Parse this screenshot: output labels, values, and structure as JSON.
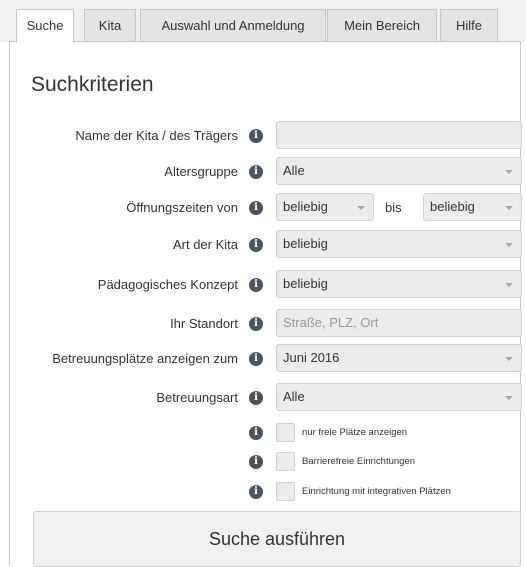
{
  "tabs": [
    {
      "label": "Suche",
      "active": true
    },
    {
      "label": "Kita",
      "active": false
    },
    {
      "label": "Auswahl und Anmeldung",
      "active": false
    },
    {
      "label": "Mein Bereich",
      "active": false
    },
    {
      "label": "Hilfe",
      "active": false
    }
  ],
  "page_title": "Suchkriterien",
  "info_glyph": "i",
  "form": {
    "name": {
      "label": "Name der Kita / des Trägers",
      "value": ""
    },
    "altersgruppe": {
      "label": "Altersgruppe",
      "value": "Alle"
    },
    "oeffnungszeiten": {
      "label": "Öffnungszeiten von",
      "from": "beliebig",
      "separator": "bis",
      "to": "beliebig"
    },
    "art": {
      "label": "Art der Kita",
      "value": "beliebig"
    },
    "konzept": {
      "label": "Pädagogisches Konzept",
      "value": "beliebig"
    },
    "standort": {
      "label": "Ihr Standort",
      "placeholder": "Straße, PLZ, Ort"
    },
    "betreuungsplaetze": {
      "label": "Betreuungsplätze anzeigen zum",
      "value": "Juni 2016"
    },
    "betreuungsart": {
      "label": "Betreuungsart",
      "value": "Alle"
    }
  },
  "checkboxes": [
    {
      "label": "nur freie Plätze anzeigen",
      "checked": false
    },
    {
      "label": "Barrierefreie Einrichtungen",
      "checked": false
    },
    {
      "label": "Einrichtung mit integrativen Plätzen",
      "checked": false
    }
  ],
  "submit_label": "Suche ausführen"
}
